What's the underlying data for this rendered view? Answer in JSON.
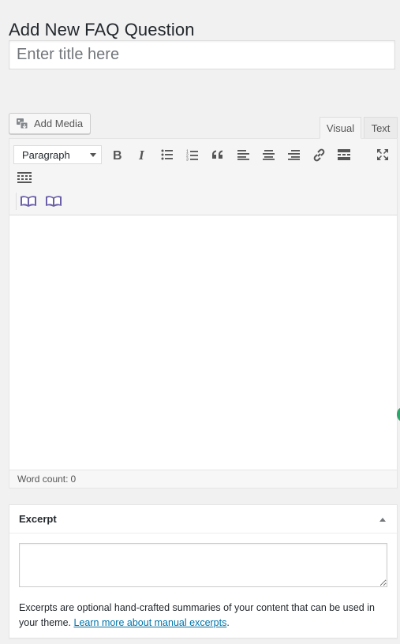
{
  "page": {
    "title": "Add New FAQ Question"
  },
  "title_field": {
    "placeholder": "Enter title here",
    "value": ""
  },
  "media": {
    "add_media_label": "Add Media"
  },
  "editor": {
    "tabs": [
      {
        "label": "Visual",
        "active": true
      },
      {
        "label": "Text",
        "active": false
      }
    ],
    "format_select": {
      "selected": "Paragraph"
    },
    "toolbar_icons": [
      "bold-icon",
      "italic-icon",
      "bulleted-list-icon",
      "numbered-list-icon",
      "blockquote-icon",
      "align-left-icon",
      "align-center-icon",
      "align-right-icon",
      "link-icon",
      "read-more-icon",
      "fullscreen-icon",
      "toolbar-toggle-icon",
      "book-icon",
      "book-icon"
    ],
    "word_count_label": "Word count:",
    "word_count": "0"
  },
  "excerpt": {
    "title": "Excerpt",
    "textarea_value": "",
    "help_text": "Excerpts are optional hand-crafted summaries of your content that can be used in your theme.",
    "help_link": "Learn more about manual excerpts",
    "help_end": "."
  },
  "colors": {
    "link": "#0073aa",
    "accent_dot": "#2ea56b",
    "background": "#f1f1f1"
  }
}
